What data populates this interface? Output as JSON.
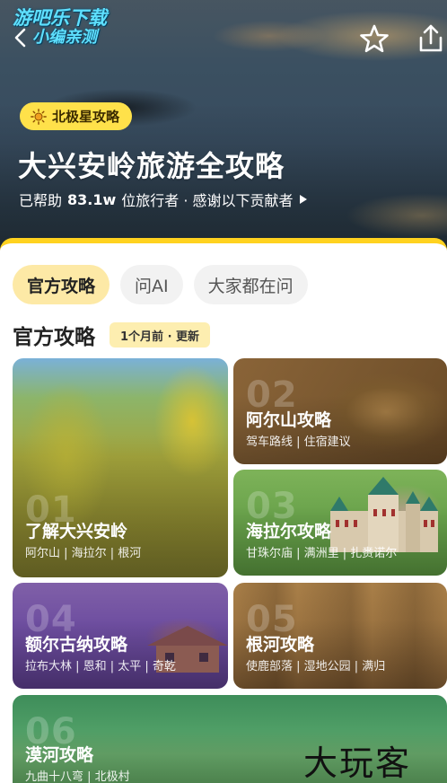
{
  "watermark": {
    "line1": "游吧乐下载",
    "line2": "小编亲测"
  },
  "hero": {
    "badge": "北极星攻略",
    "title": "大兴安岭旅游全攻略",
    "sub_prefix": "已帮助",
    "sub_count": "83.1w",
    "sub_suffix": "位旅行者 · 感谢以下贡献者"
  },
  "tabs": [
    {
      "label": "官方攻略",
      "active": true
    },
    {
      "label": "问AI",
      "active": false
    },
    {
      "label": "大家都在问",
      "active": false
    }
  ],
  "section": {
    "title": "官方攻略",
    "updated": "1个月前 · 更新"
  },
  "cards": [
    {
      "num": "01",
      "title": "了解大兴安岭",
      "sub": "阿尔山 | 海拉尔 | 根河"
    },
    {
      "num": "02",
      "title": "阿尔山攻略",
      "sub": "驾车路线 | 住宿建议"
    },
    {
      "num": "03",
      "title": "海拉尔攻略",
      "sub": "甘珠尔庙 | 满洲里 | 扎赉诺尔"
    },
    {
      "num": "04",
      "title": "额尔古纳攻略",
      "sub": "拉布大林 | 恩和 | 太平 | 奇乾"
    },
    {
      "num": "05",
      "title": "根河攻略",
      "sub": "使鹿部落 | 湿地公园 | 满归"
    },
    {
      "num": "06",
      "title": "漠河攻略",
      "sub": "九曲十八弯 | 北极村"
    }
  ],
  "stamp": "大玩客",
  "icons": {
    "back": "chevron-left-icon",
    "favorite": "star-outline-icon",
    "share": "share-icon",
    "badge": "sun-icon",
    "more": "caret-right-icon"
  },
  "colors": {
    "accent": "#ffd21f",
    "badge_bg": "#ffe14a",
    "tab_active_bg": "#fde9a6"
  }
}
